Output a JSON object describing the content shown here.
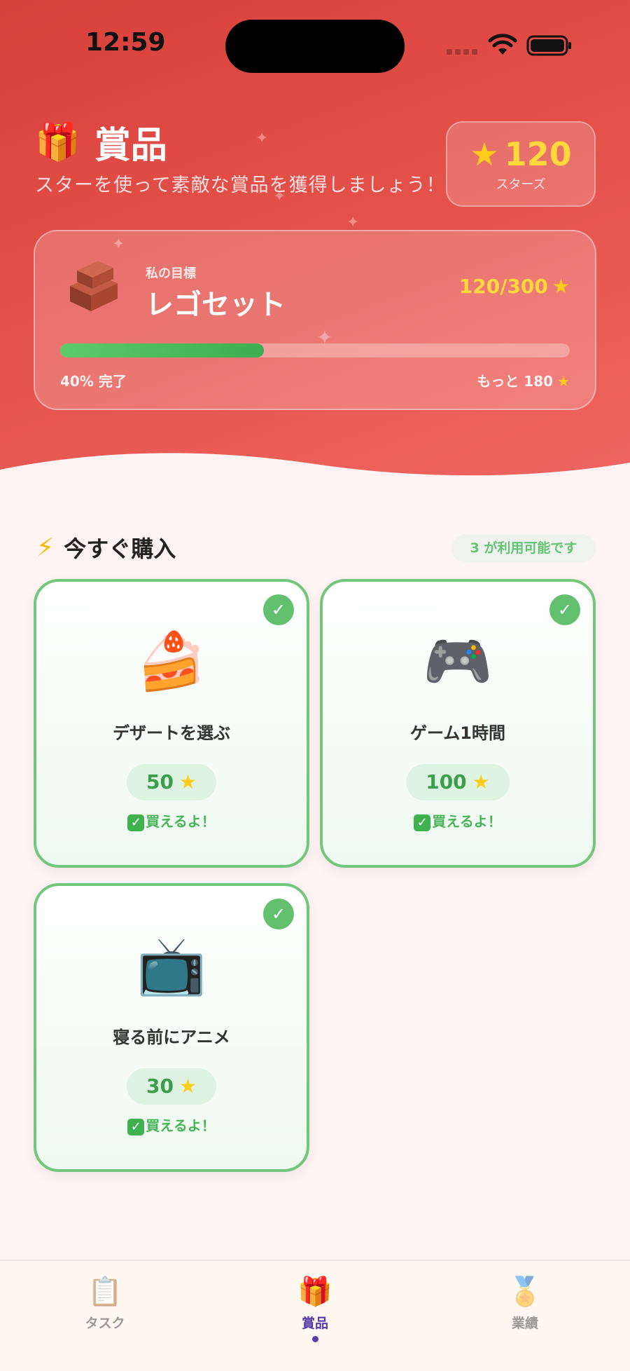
{
  "status_bar": {
    "time": "12:59"
  },
  "header": {
    "title": "賞品",
    "subtitle": "スターを使って素敵な賞品を獲得しましょう！",
    "star_count": "120",
    "star_label": "スターズ"
  },
  "goal": {
    "label": "私の目標",
    "name": "レゴセット",
    "progress_text": "120/300",
    "percent_text": "40% 完了",
    "remaining_text": "もっと 180",
    "progress_fraction": 0.4
  },
  "section": {
    "title": "今すぐ購入",
    "available_badge": "3 が利用可能です"
  },
  "rewards": [
    {
      "name": "デザートを選ぶ",
      "price": "50",
      "emoji": "🍰",
      "status": "買えるよ！"
    },
    {
      "name": "ゲーム1時間",
      "price": "100",
      "emoji": "🎮",
      "status": "買えるよ！"
    },
    {
      "name": "寝る前にアニメ",
      "price": "30",
      "emoji": "📺",
      "status": "買えるよ！"
    }
  ],
  "tabs": [
    {
      "label": "タスク",
      "icon": "clipboard-icon"
    },
    {
      "label": "賞品",
      "icon": "gift-icon",
      "active": true
    },
    {
      "label": "業績",
      "icon": "medal-icon"
    }
  ],
  "colors": {
    "hero": "#e3504a",
    "accent_green": "#63c06f",
    "star_yellow": "#ffd93b",
    "tab_active": "#5a3aa8"
  }
}
